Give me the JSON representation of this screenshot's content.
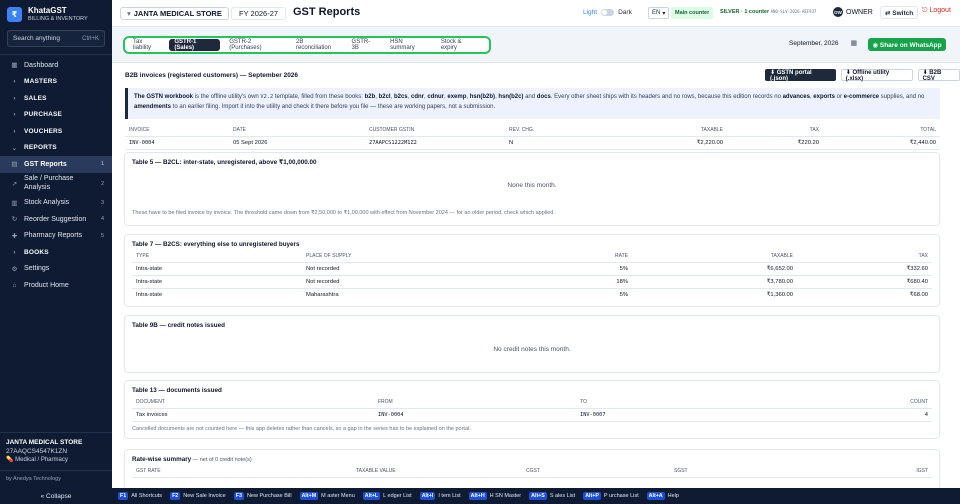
{
  "brand": {
    "logo": "₹",
    "name": "KhataGST",
    "tagline": "BILLING & INVENTORY"
  },
  "sidebar": {
    "search_placeholder": "Search anything",
    "search_shortcut": "Ctrl+K",
    "items": [
      {
        "label": "Dashboard",
        "icon": "▦",
        "count": "",
        "type": "item"
      },
      {
        "label": "MASTERS",
        "icon": "›",
        "count": "",
        "type": "group"
      },
      {
        "label": "SALES",
        "icon": "›",
        "count": "",
        "type": "group"
      },
      {
        "label": "PURCHASE",
        "icon": "›",
        "count": "",
        "type": "group"
      },
      {
        "label": "VOUCHERS",
        "icon": "›",
        "count": "",
        "type": "group"
      },
      {
        "label": "REPORTS",
        "icon": "⌄",
        "count": "",
        "type": "group"
      },
      {
        "label": "GST Reports",
        "icon": "▤",
        "count": "1",
        "type": "item active"
      },
      {
        "label": "Sale / Purchase Analysis",
        "icon": "↗",
        "count": "2",
        "type": "item two"
      },
      {
        "label": "Stock Analysis",
        "icon": "▥",
        "count": "3",
        "type": "item"
      },
      {
        "label": "Reorder Suggestion",
        "icon": "↻",
        "count": "4",
        "type": "item"
      },
      {
        "label": "Pharmacy Reports",
        "icon": "✚",
        "count": "5",
        "type": "item"
      },
      {
        "label": "BOOKS",
        "icon": "›",
        "count": "",
        "type": "group"
      },
      {
        "label": "Settings",
        "icon": "⚙",
        "count": "",
        "type": "item"
      },
      {
        "label": "Product Home",
        "icon": "⌂",
        "count": "",
        "type": "item"
      }
    ],
    "shop_name": "JANTA MEDICAL STORE",
    "shop_gstin": "27AAQCS4547K1ZN",
    "shop_type": "💊 Medical / Pharmacy",
    "byline": "by Anedya Technology",
    "collapse_label": "« Collapse"
  },
  "header": {
    "shop": "JANTA MEDICAL STORE",
    "fy": "FY 2026-27",
    "title": "GST Reports",
    "theme_light": "Light",
    "theme_dark": "Dark",
    "lang": "EN",
    "counter": "Main counter",
    "license": "SILVER · 1 counter",
    "license_code": "ANO-SLV-2026-AEF937",
    "avatar": "OW",
    "role": "OWNER",
    "switch": "⇄ Switch",
    "logout": "⎋ Logout"
  },
  "tabs": [
    "Tax liability",
    "GSTR-1 (Sales)",
    "GSTR-2 (Purchases)",
    "2B reconciliation",
    "GSTR-3B",
    "HSN summary",
    "Stock & expiry"
  ],
  "period": "September, 2026",
  "whatsapp": "◉ Share on WhatsApp",
  "b2b": {
    "title": "B2B invoices (registered customers) — September 2026",
    "downloads": [
      "⬇ GSTN portal (.json)",
      "⬇ Offline utility (.xlsx)",
      "⬇ B2B CSV"
    ],
    "info": {
      "p1": "The GSTN workbook",
      "p2": " is the offline utility's own ",
      "p3": "V2.2",
      "p4": " template, filled from these books: ",
      "books": [
        "b2b",
        "b2cl",
        "b2cs",
        "cdnr",
        "cdnur",
        "exemp",
        "hsn(b2b)",
        "hsn(b2c)"
      ],
      "p5": " and ",
      "docs": "docs",
      "p6": ". Every other sheet ships with its headers and no rows, because this edition records no ",
      "w1": "advances",
      "w2": "exports",
      "w3": "e-commerce",
      "p7": " supplies, and no ",
      "w4": "amendments",
      "p8": " to an earlier filing. Import it into the utility and check it there before you file — these are working papers, not a submission.",
      "sep": ", ",
      "or": " or ",
      "l1": " "
    },
    "columns": [
      "INVOICE",
      "DATE",
      "CUSTOMER GSTIN",
      "REV. CHG.",
      "TAXABLE",
      "TAX",
      "TOTAL"
    ],
    "rows": [
      [
        "INV-0004",
        "05 Sept 2026",
        "27AAPCS1222M1Z2",
        "N",
        "₹2,220.00",
        "₹220.20",
        "₹2,440.00"
      ]
    ]
  },
  "b2cl": {
    "title": "Table 5 — B2CL: inter-state, unregistered, above ₹1,00,000.00",
    "empty": "None this month.",
    "note": "These have to be filed invoice by invoice. The threshold came down from ₹2,50,000 to ₹1,00,000 with effect from November 2024 — for an older period, check which applied."
  },
  "b2cs": {
    "title": "Table 7 — B2CS: everything else to unregistered buyers",
    "columns": [
      "TYPE",
      "PLACE OF SUPPLY",
      "RATE",
      "TAXABLE",
      "TAX"
    ],
    "rows": [
      [
        "Intra-state",
        "Not recorded",
        "5%",
        "₹6,652.00",
        "₹332.60"
      ],
      [
        "Intra-state",
        "Not recorded",
        "18%",
        "₹3,780.00",
        "₹680.40"
      ],
      [
        "Intra-state",
        "Maharashtra",
        "5%",
        "₹1,360.00",
        "₹68.00"
      ]
    ]
  },
  "credit": {
    "title": "Table 9B — credit notes issued",
    "empty": "No credit notes this month."
  },
  "docs": {
    "title": "Table 13 — documents issued",
    "columns": [
      "DOCUMENT",
      "FROM",
      "TO",
      "COUNT"
    ],
    "rows": [
      [
        "Tax invoices",
        "INV-0004",
        "INV-0007",
        "4"
      ]
    ],
    "note": "Cancelled documents are not counted here — this app deletes rather than cancels, so a gap in the series has to be explained on the portal."
  },
  "ratewise": {
    "title": "Rate-wise summary",
    "subtitle": " — net of 0 credit note(s)",
    "columns": [
      "GST RATE",
      "TAXABLE VALUE",
      "CGST",
      "SGST",
      "IGST"
    ]
  },
  "shortcuts": [
    {
      "key": "F1",
      "label": "All Shortcuts"
    },
    {
      "key": "F2",
      "label": "New Sale Invoice"
    },
    {
      "key": "F3",
      "label": "New Purchase Bill"
    },
    {
      "key": "Alt+M",
      "label": "M aster Menu"
    },
    {
      "key": "Alt+L",
      "label": "L edger List"
    },
    {
      "key": "Alt+I",
      "label": "I tem List"
    },
    {
      "key": "Alt+H",
      "label": "H SN Master"
    },
    {
      "key": "Alt+S",
      "label": "S ales List"
    },
    {
      "key": "Alt+P",
      "label": "P urchase List"
    },
    {
      "key": "Alt+A",
      "label": "Help"
    }
  ],
  "colors": {
    "sidebar": "#0f1b33",
    "accent": "#1e293b",
    "tabs_border": "#22c55e",
    "whatsapp": "#16a34a",
    "logout": "#dc2626",
    "shortcut_key": "#1d4ed8"
  }
}
